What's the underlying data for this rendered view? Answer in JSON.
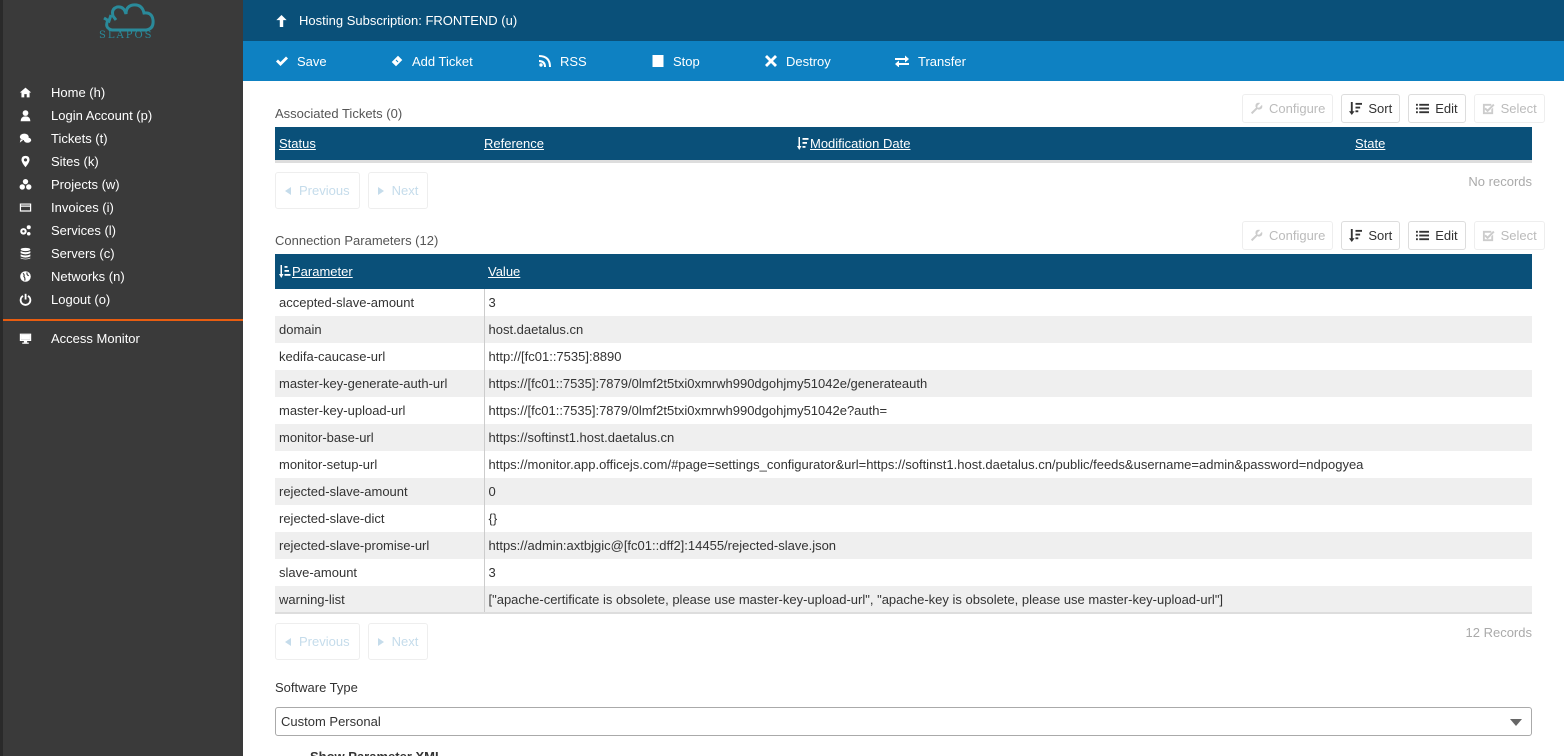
{
  "app": {
    "logo_text": "SLAPOS",
    "brand_color": "#2a8a9a",
    "accent_color": "#e95d10"
  },
  "sidebar": {
    "items": [
      {
        "label": "Home (h)",
        "icon": "home-icon"
      },
      {
        "label": "Login Account (p)",
        "icon": "user-icon"
      },
      {
        "label": "Tickets (t)",
        "icon": "comments-icon"
      },
      {
        "label": "Sites (k)",
        "icon": "map-marker-icon"
      },
      {
        "label": "Projects (w)",
        "icon": "cubes-icon"
      },
      {
        "label": "Invoices (i)",
        "icon": "credit-card-icon"
      },
      {
        "label": "Services (l)",
        "icon": "cogs-icon"
      },
      {
        "label": "Servers (c)",
        "icon": "database-icon"
      },
      {
        "label": "Networks (n)",
        "icon": "globe-icon"
      },
      {
        "label": "Logout (o)",
        "icon": "power-icon"
      }
    ],
    "extra_items": [
      {
        "label": "Access Monitor",
        "icon": "desktop-icon"
      }
    ]
  },
  "header": {
    "title": "Hosting Subscription: FRONTEND (u)",
    "icon": "arrow-up-icon"
  },
  "actions": {
    "save": "Save",
    "add_ticket": "Add Ticket",
    "rss": "RSS",
    "stop": "Stop",
    "destroy": "Destroy",
    "transfer": "Transfer"
  },
  "toolbar": {
    "configure": "Configure",
    "sort": "Sort",
    "edit": "Edit",
    "select": "Select"
  },
  "tickets": {
    "title": "Associated Tickets (0)",
    "columns": [
      "Status",
      "Reference",
      "Modification Date",
      "State"
    ],
    "sorted_column": "Modification Date",
    "rows": [],
    "records_text": "No records",
    "previous": "Previous",
    "next": "Next"
  },
  "connection": {
    "title": "Connection Parameters (12)",
    "columns": [
      "Parameter",
      "Value"
    ],
    "sorted_column": "Parameter",
    "rows": [
      {
        "parameter": "accepted-slave-amount",
        "value": "3"
      },
      {
        "parameter": "domain",
        "value": "host.daetalus.cn"
      },
      {
        "parameter": "kedifa-caucase-url",
        "value": "http://[fc01::7535]:8890"
      },
      {
        "parameter": "master-key-generate-auth-url",
        "value": "https://[fc01::7535]:7879/0lmf2t5txi0xmrwh990dgohjmy51042e/generateauth"
      },
      {
        "parameter": "master-key-upload-url",
        "value": "https://[fc01::7535]:7879/0lmf2t5txi0xmrwh990dgohjmy51042e?auth="
      },
      {
        "parameter": "monitor-base-url",
        "value": "https://softinst1.host.daetalus.cn"
      },
      {
        "parameter": "monitor-setup-url",
        "value": "https://monitor.app.officejs.com/#page=settings_configurator&url=https://softinst1.host.daetalus.cn/public/feeds&username=admin&password=ndpogyea"
      },
      {
        "parameter": "rejected-slave-amount",
        "value": "0"
      },
      {
        "parameter": "rejected-slave-dict",
        "value": "{}"
      },
      {
        "parameter": "rejected-slave-promise-url",
        "value": "https://admin:axtbjgic@[fc01::dff2]:14455/rejected-slave.json"
      },
      {
        "parameter": "slave-amount",
        "value": "3"
      },
      {
        "parameter": "warning-list",
        "value": "[\"apache-certificate is obsolete, please use master-key-upload-url\", \"apache-key is obsolete, please use master-key-upload-url\"]"
      }
    ],
    "records_text": "12 Records",
    "previous": "Previous",
    "next": "Next"
  },
  "software_type": {
    "label": "Software Type",
    "selected": "Custom Personal"
  },
  "next_section_partial": "Show Parameter XML"
}
